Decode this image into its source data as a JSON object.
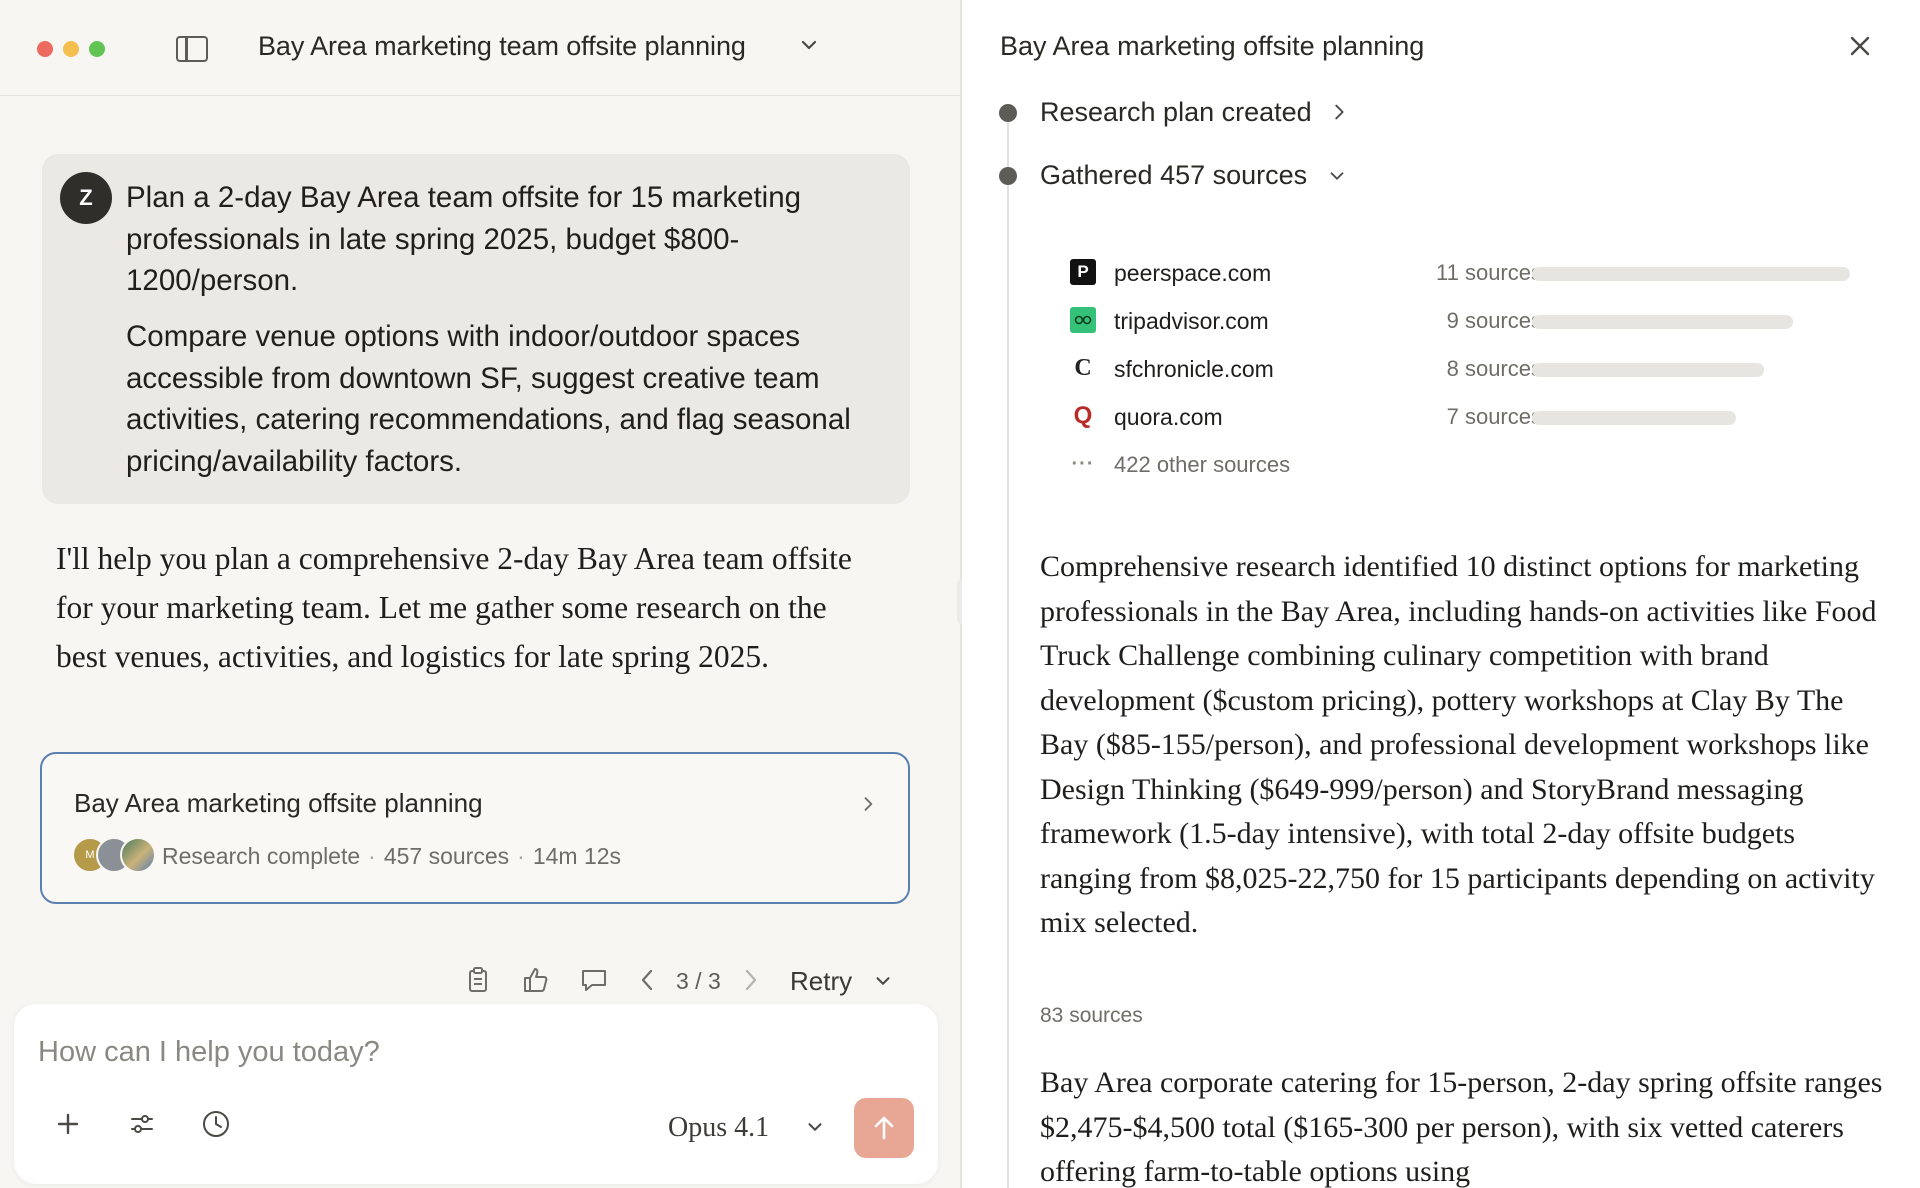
{
  "left_pane": {
    "title": "Bay Area marketing team offsite planning",
    "user_message": {
      "avatar_initial": "Z",
      "paragraph_1": "Plan a 2-day Bay Area team offsite for 15 marketing professionals in late spring 2025, budget $800-1200/person.",
      "paragraph_2": "Compare venue options with indoor/outdoor spaces accessible from downtown SF, suggest creative team activities, catering recommendations, and flag seasonal pricing/availability factors."
    },
    "assistant_message": "I'll help you plan a comprehensive 2-day Bay Area team offsite for your marketing team. Let me gather some research on the best venues, activities, and logistics for late spring 2025.",
    "research_card": {
      "title": "Bay Area marketing offsite planning",
      "avatar_initials": "M",
      "status": "Research complete",
      "sources": "457 sources",
      "duration": "14m 12s"
    },
    "actions": {
      "pager": "3 / 3",
      "retry_label": "Retry"
    },
    "composer": {
      "placeholder": "How can I help you today?",
      "model": "Opus 4.1"
    }
  },
  "right_pane": {
    "title": "Bay Area marketing offsite planning",
    "steps": [
      {
        "label": "Research plan created"
      },
      {
        "label": "Gathered 457 sources"
      }
    ],
    "sources": [
      {
        "domain": "peerspace.com",
        "count": "11 sources",
        "share": 1.0
      },
      {
        "domain": "tripadvisor.com",
        "count": "9 sources",
        "share": 0.82
      },
      {
        "domain": "sfchronicle.com",
        "count": "8 sources",
        "share": 0.73
      },
      {
        "domain": "quora.com",
        "count": "7 sources",
        "share": 0.64
      }
    ],
    "other_sources": "422 other sources",
    "source_icons": [
      "P",
      "oo",
      "C",
      "Q",
      "···"
    ],
    "findings": [
      {
        "text": "Comprehensive research identified 10 distinct options for marketing professionals in the Bay Area, including hands-on activities like Food Truck Challenge combining culinary competition with brand development ($custom pricing), pottery workshops at Clay By The Bay ($85-155/person), and professional development workshops like Design Thinking ($649-999/person) and StoryBrand messaging framework (1.5-day intensive), with total 2-day offsite budgets ranging from $8,025-22,750 for 15 participants depending on activity mix selected.",
        "sources": "83 sources"
      },
      {
        "text": "Bay Area corporate catering for 15-person, 2-day spring offsite ranges $2,475-$4,500 total ($165-300 per person), with six vetted caterers offering farm-to-table options using"
      }
    ]
  },
  "colors": {
    "accent_send": "#e8a695",
    "card_border": "#5b7fae",
    "tripadvisor_green": "#34c279",
    "quora_red": "#b92b27"
  }
}
